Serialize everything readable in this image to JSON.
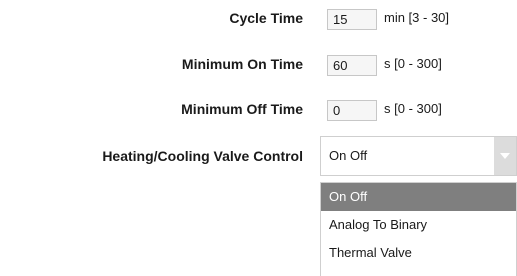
{
  "fields": {
    "cycle_time": {
      "label": "Cycle Time",
      "value": "15",
      "unit": "min [3 - 30]"
    },
    "min_on_time": {
      "label": "Minimum On Time",
      "value": "60",
      "unit": "s [0 - 300]"
    },
    "min_off_time": {
      "label": "Minimum Off Time",
      "value": "0",
      "unit": "s [0 - 300]"
    }
  },
  "valve_control": {
    "label": "Heating/Cooling Valve Control",
    "selected": "On Off",
    "options": [
      "On Off",
      "Analog To Binary",
      "Thermal Valve"
    ]
  },
  "icons": {
    "dropdown_arrow": "chevron-down-icon"
  }
}
